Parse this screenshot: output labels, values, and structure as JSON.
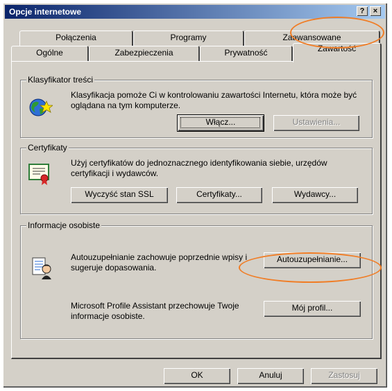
{
  "window": {
    "title": "Opcje internetowe",
    "help_button": "?",
    "close_button": "×"
  },
  "tabs": {
    "back_row": [
      "Połączenia",
      "Programy",
      "Zaawansowane"
    ],
    "front_row": [
      "Ogólne",
      "Zabezpieczenia",
      "Prywatność",
      "Zawartość"
    ],
    "active": "Zawartość"
  },
  "content_advisor": {
    "title": "Klasyfikator treści",
    "description": "Klasyfikacja pomoże Ci w kontrolowaniu zawartości Internetu, która może być oglądana na tym komputerze.",
    "enable_button": "Włącz...",
    "settings_button": "Ustawienia..."
  },
  "certificates": {
    "title": "Certyfikaty",
    "description": "Użyj certyfikatów do jednoznacznego identyfikowania siebie, urzędów certyfikacji i wydawców.",
    "clear_ssl_button": "Wyczyść stan SSL",
    "certificates_button": "Certyfikaty...",
    "publishers_button": "Wydawcy..."
  },
  "personal_info": {
    "title": "Informacje osobiste",
    "autocomplete_text": "Autouzupełnianie zachowuje poprzednie wpisy i sugeruje dopasowania.",
    "autocomplete_button": "Autouzupełnianie...",
    "profile_text": "Microsoft Profile Assistant przechowuje Twoje informacje osobiste.",
    "profile_button": "Mój profil..."
  },
  "footer": {
    "ok_button": "OK",
    "cancel_button": "Anuluj",
    "apply_button": "Zastosuj"
  },
  "annotation_color": "#f07d26"
}
